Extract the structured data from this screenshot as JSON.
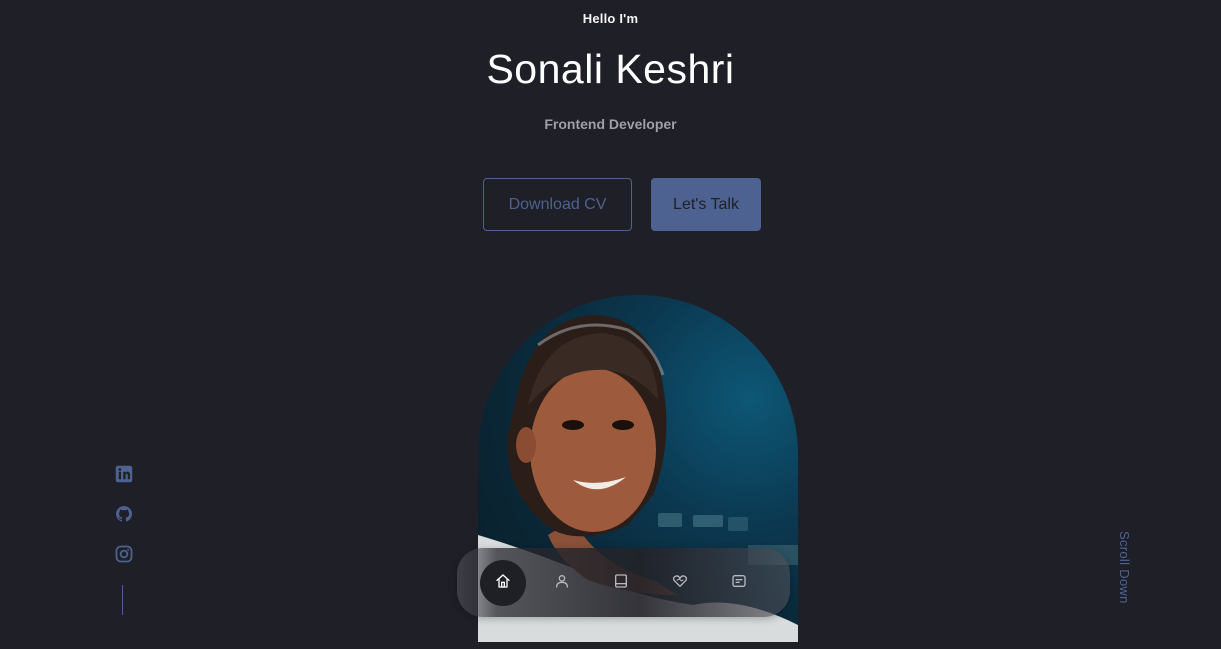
{
  "hero": {
    "greeting": "Hello I'm",
    "name": "Sonali Keshri",
    "role": "Frontend Developer",
    "download_cv_label": "Download CV",
    "lets_talk_label": "Let's Talk"
  },
  "socials": [
    {
      "name": "LinkedIn",
      "icon": "linkedin-icon"
    },
    {
      "name": "GitHub",
      "icon": "github-icon"
    },
    {
      "name": "Instagram",
      "icon": "instagram-icon"
    }
  ],
  "scroll_down_label": "Scroll Down",
  "nav": {
    "items": [
      {
        "icon": "home-icon",
        "active": true
      },
      {
        "icon": "user-icon",
        "active": false
      },
      {
        "icon": "book-icon",
        "active": false
      },
      {
        "icon": "services-icon",
        "active": false
      },
      {
        "icon": "message-icon",
        "active": false
      }
    ]
  },
  "colors": {
    "background": "#1f1f27",
    "accent": "#4d6291",
    "text_primary": "#ffffff",
    "text_muted": "#9f9fa8"
  }
}
